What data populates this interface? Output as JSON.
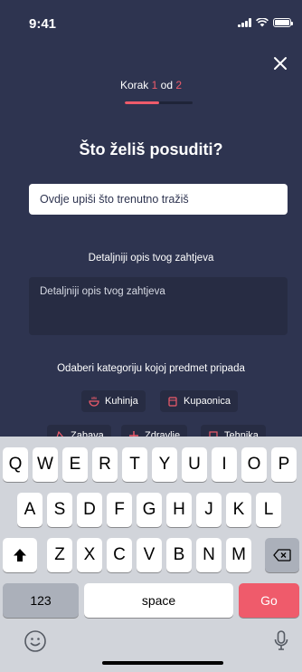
{
  "status": {
    "time": "9:41"
  },
  "step": {
    "prefix": "Korak",
    "current": "1",
    "middle": "od",
    "total": "2",
    "progress_fraction": 0.5
  },
  "title": "Što želiš posuditi?",
  "search": {
    "placeholder": "Ovdje upiši što trenutno tražiš"
  },
  "details": {
    "label": "Detaljniji opis tvog zahtjeva",
    "placeholder": "Detaljniji opis tvog zahtjeva"
  },
  "categories": {
    "label": "Odaberi kategoriju kojoj predmet pripada",
    "items": [
      {
        "label": "Kuhinja",
        "icon": "bowl-icon"
      },
      {
        "label": "Kupaonica",
        "icon": "towel-icon"
      },
      {
        "label": "Zabava",
        "icon": "party-icon"
      },
      {
        "label": "Zdravlje",
        "icon": "health-icon"
      },
      {
        "label": "Tehnika",
        "icon": "laptop-icon"
      }
    ]
  },
  "colors": {
    "background": "#2e3450",
    "accent": "#ef5b6b",
    "field_dark": "#272c43"
  },
  "keyboard": {
    "row1": [
      "Q",
      "W",
      "E",
      "R",
      "T",
      "Y",
      "U",
      "I",
      "O",
      "P"
    ],
    "row2": [
      "A",
      "S",
      "D",
      "F",
      "G",
      "H",
      "J",
      "K",
      "L"
    ],
    "row3": [
      "Z",
      "X",
      "C",
      "V",
      "B",
      "N",
      "M"
    ],
    "numbers": "123",
    "space": "space",
    "go": "Go"
  }
}
